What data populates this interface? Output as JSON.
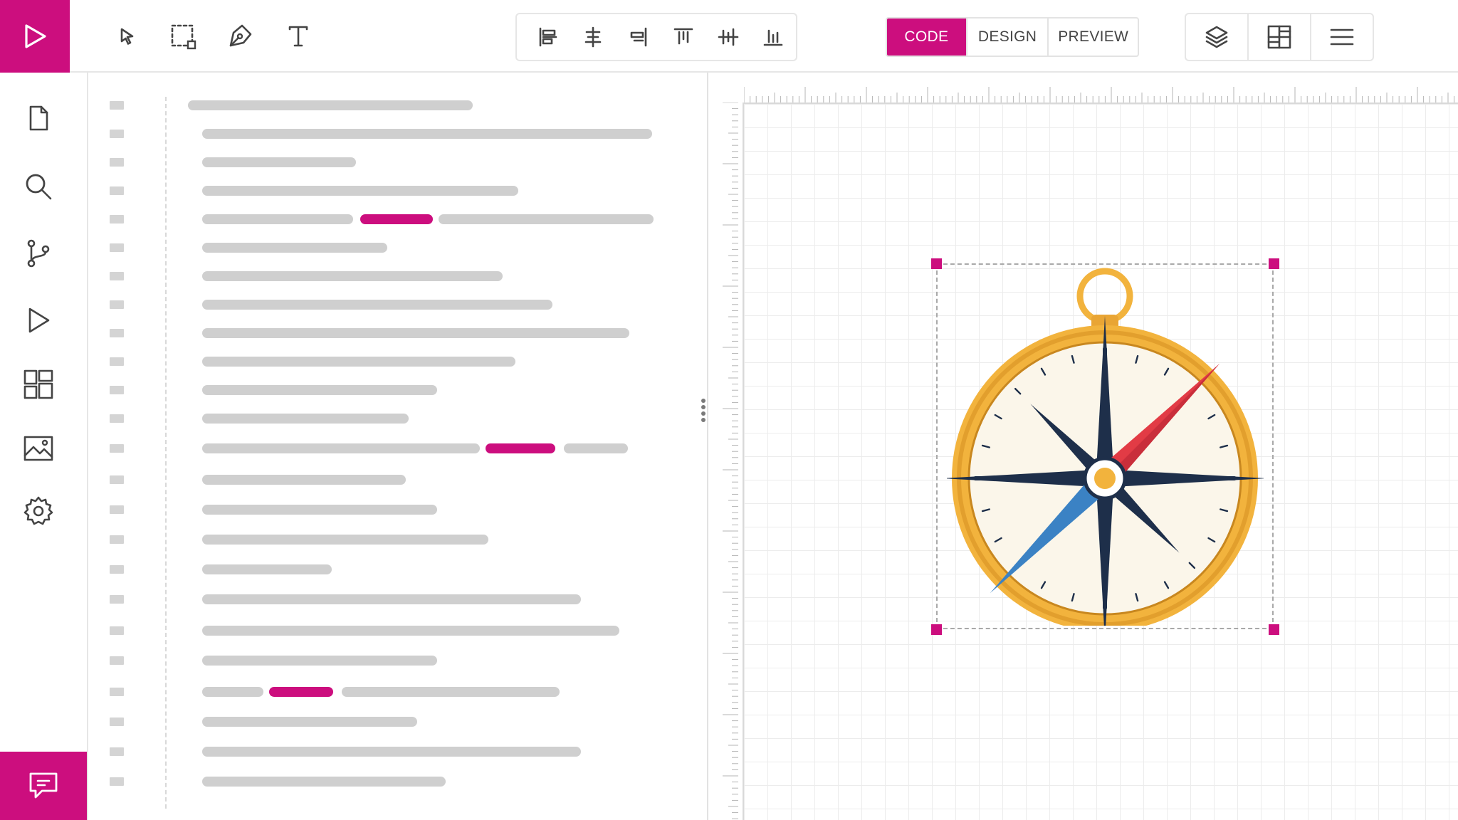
{
  "app": {
    "brand_icon": "play-icon",
    "accent_color": "#cc0e7e"
  },
  "toolbar": {
    "tools": [
      "select-arrow-icon",
      "marquee-select-icon",
      "pen-tool-icon",
      "text-tool-icon"
    ],
    "align_tools": [
      "align-left-icon",
      "align-center-horizontal-icon",
      "align-right-icon",
      "align-top-icon",
      "align-middle-vertical-icon",
      "align-bottom-icon"
    ],
    "mode_tabs": [
      {
        "label": "CODE",
        "active": true
      },
      {
        "label": "DESIGN",
        "active": false
      },
      {
        "label": "PREVIEW",
        "active": false
      }
    ],
    "view_tools": [
      "layers-icon",
      "grid-view-icon",
      "menu-icon"
    ]
  },
  "sidebar": {
    "items": [
      "file-icon",
      "search-icon",
      "source-control-icon",
      "run-icon",
      "components-icon",
      "image-icon",
      "settings-icon"
    ],
    "bottom": "chat-icon"
  },
  "canvas": {
    "selected_object": "compass-icon",
    "compass_colors": {
      "ring": "#f2b33d",
      "face": "#fbf6ea",
      "star": "#1e2f4a",
      "north_needle": "#e23b45",
      "south_needle": "#3b82c4"
    }
  }
}
